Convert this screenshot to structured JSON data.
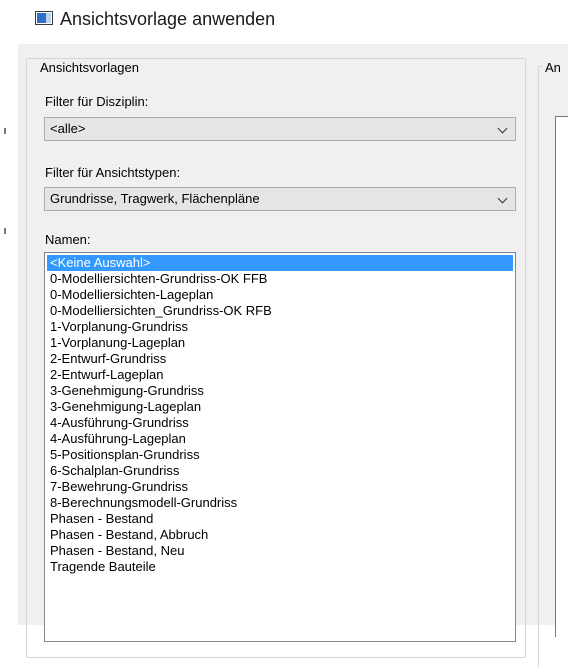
{
  "window": {
    "title": "Ansichtsvorlage anwenden",
    "icon": "window-app-icon"
  },
  "templates_group": {
    "legend": "Ansichtsvorlagen",
    "discipline_filter": {
      "label": "Filter für Disziplin:",
      "selected": "<alle>"
    },
    "viewtype_filter": {
      "label": "Filter für Ansichtstypen:",
      "selected": "Grundrisse, Tragwerk, Flächenpläne"
    },
    "names": {
      "label": "Namen:",
      "selected_index": 0,
      "items": [
        "<Keine Auswahl>",
        "0-Modelliersichten-Grundriss-OK FFB",
        "0-Modelliersichten-Lageplan",
        "0-Modelliersichten_Grundriss-OK RFB",
        "1-Vorplanung-Grundriss",
        "1-Vorplanung-Lageplan",
        "2-Entwurf-Grundriss",
        "2-Entwurf-Lageplan",
        "3-Genehmigung-Grundriss",
        "3-Genehmigung-Lageplan",
        "4-Ausführung-Grundriss",
        "4-Ausführung-Lageplan",
        "5-Positionsplan-Grundriss",
        "6-Schalplan-Grundriss",
        "7-Bewehrung-Grundriss",
        "8-Berechnungsmodell-Grundriss",
        "Phasen - Bestand",
        "Phasen - Bestand, Abbruch",
        "Phasen - Bestand, Neu",
        "Tragende Bauteile"
      ]
    }
  },
  "right_group": {
    "legend_fragment": "An"
  },
  "colors": {
    "selection": "#3399ff",
    "dialog_bg": "#f0f0f0",
    "combo_bg": "#e5e5e5"
  }
}
